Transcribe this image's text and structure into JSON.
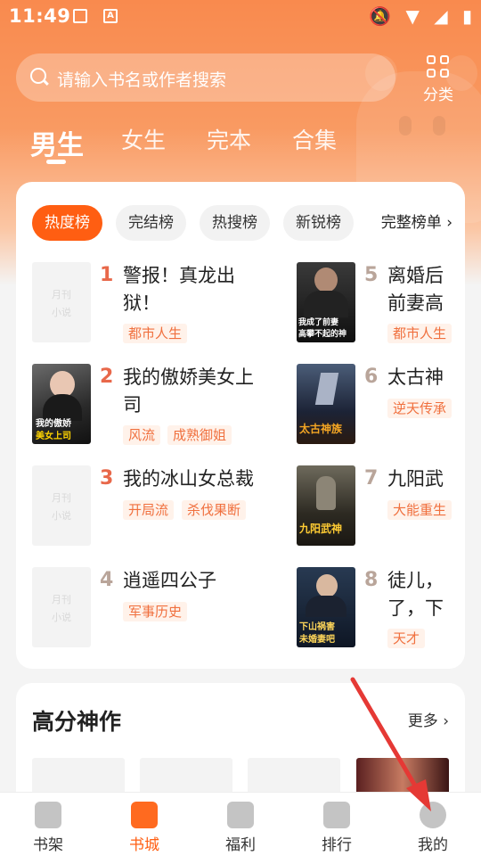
{
  "status_bar": {
    "time": "11:49",
    "icons": [
      "image-icon",
      "font-icon",
      "mute-icon",
      "wifi-icon",
      "signal-icon",
      "battery-icon"
    ]
  },
  "search": {
    "placeholder": "请输入书名或作者搜索"
  },
  "category": {
    "label": "分类"
  },
  "top_tabs": [
    {
      "label": "男生",
      "active": true
    },
    {
      "label": "女生",
      "active": false
    },
    {
      "label": "完本",
      "active": false
    },
    {
      "label": "合集",
      "active": false
    }
  ],
  "rank_chips": [
    "热度榜",
    "完结榜",
    "热搜榜",
    "新锐榜"
  ],
  "full_rank_label": "完整榜单",
  "books": [
    {
      "rank": "1",
      "title": "警报！真龙出狱！",
      "tags": [
        "都市人生"
      ],
      "cover": "placeholder",
      "cover_text": [
        "月刊",
        "小说"
      ]
    },
    {
      "rank": "2",
      "title": "我的傲娇美女上司",
      "tags": [
        "风流",
        "成熟御姐"
      ],
      "cover": "image",
      "cover_text": [
        "我的傲娇",
        "美女上司"
      ]
    },
    {
      "rank": "3",
      "title": "我的冰山女总裁",
      "tags": [
        "开局流",
        "杀伐果断"
      ],
      "cover": "placeholder",
      "cover_text": [
        "月刊",
        "小说"
      ]
    },
    {
      "rank": "4",
      "title": "逍遥四公子",
      "tags": [
        "军事历史"
      ],
      "cover": "placeholder",
      "cover_text": [
        "月刊",
        "小说"
      ]
    },
    {
      "rank": "5",
      "title": "离婚后前妻高",
      "tags": [
        "都市人生"
      ],
      "cover": "image",
      "cover_text": [
        "我成了前妻",
        "高攀不起的神"
      ]
    },
    {
      "rank": "6",
      "title": "太古神",
      "tags": [
        "逆天传承"
      ],
      "cover": "image",
      "cover_text": [
        "太古神族"
      ]
    },
    {
      "rank": "7",
      "title": "九阳武",
      "tags": [
        "大能重生"
      ],
      "cover": "image",
      "cover_text": [
        "九阳武神"
      ]
    },
    {
      "rank": "8",
      "title": "徒儿，了，下",
      "tags": [
        "天才"
      ],
      "cover": "image",
      "cover_text": [
        "下山祸害",
        "未婚妻吧"
      ]
    }
  ],
  "high_score": {
    "title": "高分神作",
    "more": "更多"
  },
  "bottom_nav": [
    {
      "label": "书架",
      "icon": "bookshelf-icon",
      "active": false
    },
    {
      "label": "书城",
      "icon": "bookstore-icon",
      "active": true
    },
    {
      "label": "福利",
      "icon": "gift-icon",
      "active": false
    },
    {
      "label": "排行",
      "icon": "ranking-icon",
      "active": false
    },
    {
      "label": "我的",
      "icon": "profile-icon",
      "active": false
    }
  ],
  "colors": {
    "accent": "#ff5e12",
    "hero": "#f98a4e",
    "tag_text": "#f0703e",
    "rank_hot": "#e8684a",
    "annotation_arrow": "#e53935"
  }
}
